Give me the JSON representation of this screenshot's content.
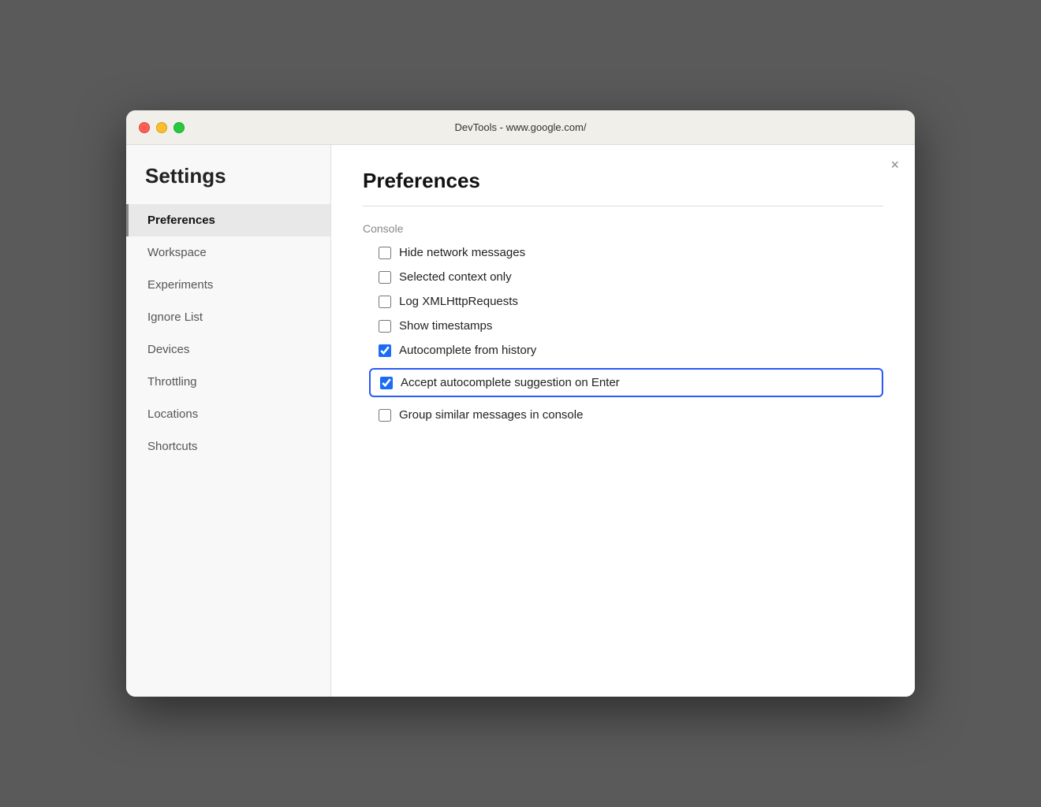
{
  "titlebar": {
    "title": "DevTools - www.google.com/"
  },
  "sidebar": {
    "heading": "Settings",
    "items": [
      {
        "id": "preferences",
        "label": "Preferences",
        "active": true
      },
      {
        "id": "workspace",
        "label": "Workspace",
        "active": false
      },
      {
        "id": "experiments",
        "label": "Experiments",
        "active": false
      },
      {
        "id": "ignore-list",
        "label": "Ignore List",
        "active": false
      },
      {
        "id": "devices",
        "label": "Devices",
        "active": false
      },
      {
        "id": "throttling",
        "label": "Throttling",
        "active": false
      },
      {
        "id": "locations",
        "label": "Locations",
        "active": false
      },
      {
        "id": "shortcuts",
        "label": "Shortcuts",
        "active": false
      }
    ]
  },
  "main": {
    "title": "Preferences",
    "close_label": "×",
    "section": {
      "title": "Console",
      "checkboxes": [
        {
          "id": "hide-network",
          "label": "Hide network messages",
          "checked": false,
          "highlighted": false
        },
        {
          "id": "selected-context",
          "label": "Selected context only",
          "checked": false,
          "highlighted": false
        },
        {
          "id": "log-xml",
          "label": "Log XMLHttpRequests",
          "checked": false,
          "highlighted": false
        },
        {
          "id": "show-timestamps",
          "label": "Show timestamps",
          "checked": false,
          "highlighted": false
        },
        {
          "id": "autocomplete-history",
          "label": "Autocomplete from history",
          "checked": true,
          "highlighted": false
        },
        {
          "id": "autocomplete-enter",
          "label": "Accept autocomplete suggestion on Enter",
          "checked": true,
          "highlighted": true
        },
        {
          "id": "group-similar",
          "label": "Group similar messages in console",
          "checked": false,
          "highlighted": false
        }
      ]
    }
  }
}
